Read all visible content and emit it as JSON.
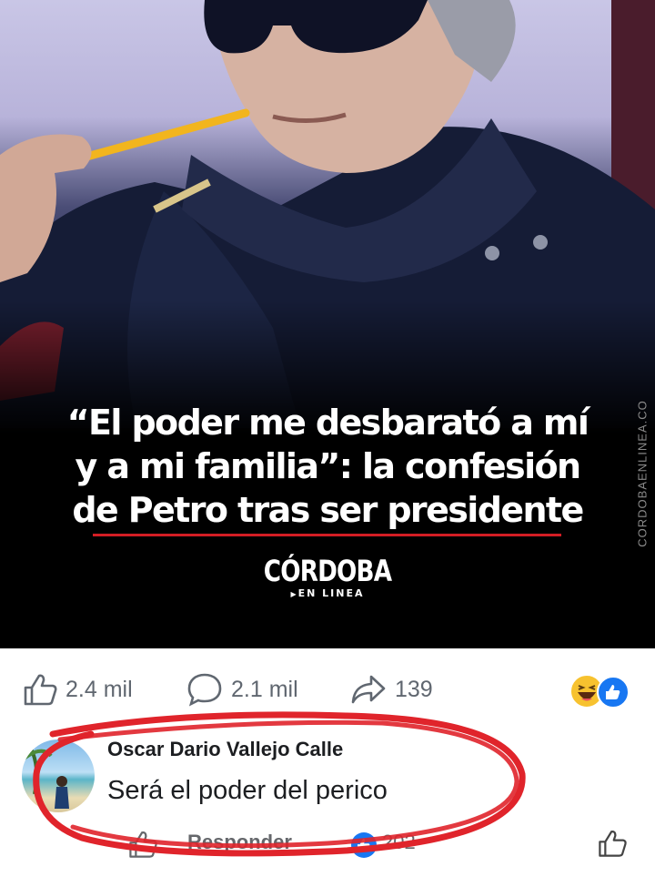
{
  "post": {
    "headline_lines": [
      "“El poder me desbarató a mí",
      "y a mi familia”: la confesión",
      "de Petro tras ser presidente"
    ],
    "brand_name": "CÓRDOBA",
    "brand_sub": "EN LINEA",
    "watermark": "CORDOBAENLINEA.CO"
  },
  "reactions": {
    "likes": "2.4 mil",
    "comments": "2.1 mil",
    "shares": "139",
    "icons": [
      "thumbs-up-icon",
      "comment-icon",
      "share-icon",
      "haha-emoji-icon",
      "like-reaction-icon"
    ]
  },
  "comment": {
    "author": "Oscar Dario Vallejo Calle",
    "text": "Será el poder del perico",
    "reply_label": "Responder",
    "reaction_count": "202"
  },
  "colors": {
    "annotation_red": "#e0242b",
    "facebook_blue": "#1877f2",
    "text_gray": "#606770"
  }
}
